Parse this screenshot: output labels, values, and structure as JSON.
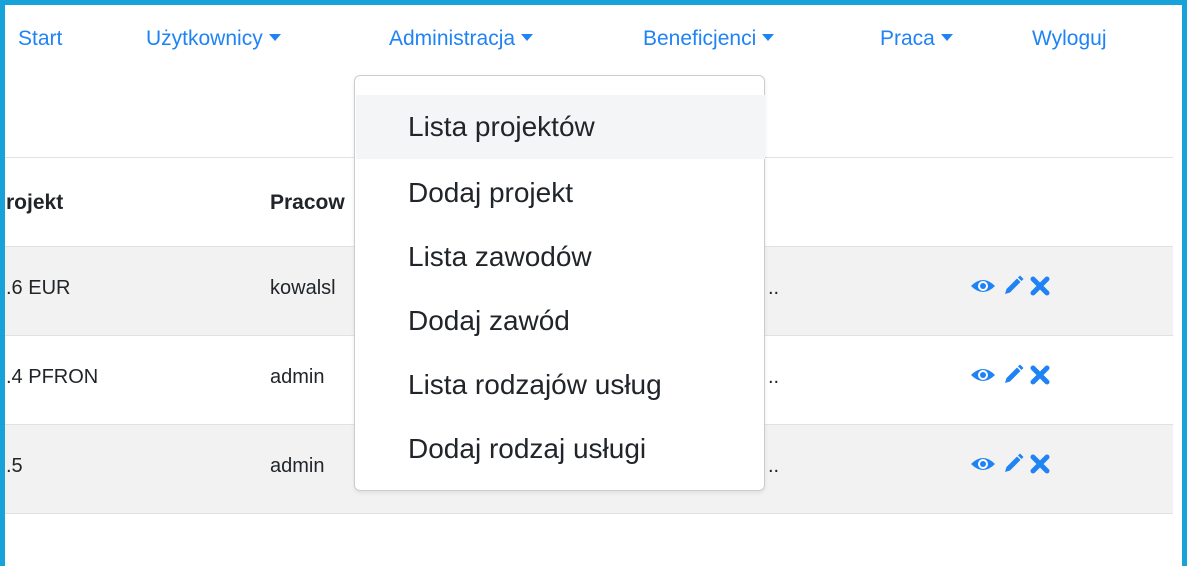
{
  "nav": {
    "start": "Start",
    "users": "Użytkownicy",
    "administration": "Administracja",
    "beneficiaries": "Beneficjenci",
    "work": "Praca",
    "logout": "Wyloguj"
  },
  "dropdown": {
    "items": [
      "Lista projektów",
      "Dodaj projekt",
      "Lista zawodów",
      "Dodaj zawód",
      "Lista rodzajów usług",
      "Dodaj rodzaj usługi"
    ]
  },
  "table": {
    "headers": [
      "rojekt",
      "Pracow"
    ],
    "rows": [
      {
        "project": ".6 EUR",
        "employee": "kowalsl",
        "trail": ".."
      },
      {
        "project": ".4 PFRON",
        "employee": "admin",
        "trail": ".."
      },
      {
        "project": ".5",
        "employee": "admin",
        "trail": ".."
      }
    ]
  },
  "icons": {
    "row_actions": [
      "eye-icon",
      "pencil-icon",
      "close-icon"
    ],
    "caret": "caret-down-icon"
  },
  "colors": {
    "accent": "#1f83f5",
    "frame": "#17a2d9",
    "striped_row": "#f2f2f2"
  }
}
